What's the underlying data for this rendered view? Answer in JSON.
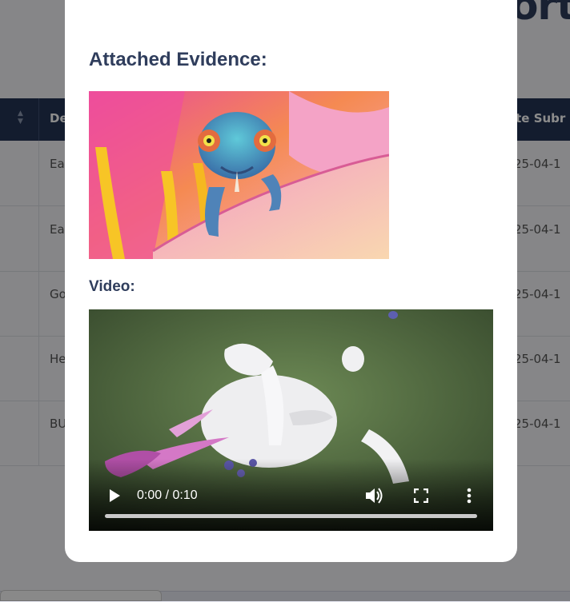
{
  "background": {
    "title_fragment": "ort",
    "table": {
      "headers": {
        "description": "De",
        "date_submitted": "ate Subr"
      },
      "rows": [
        {
          "description": "Ea",
          "date": "25-04-1"
        },
        {
          "description": "Ea",
          "date": "25-04-1"
        },
        {
          "description": "Go",
          "date": "25-04-1"
        },
        {
          "description": "He",
          "date": "25-04-1"
        },
        {
          "description": "BU",
          "date": "25-04-1"
        }
      ]
    }
  },
  "modal": {
    "evidence_heading": "Attached Evidence:",
    "video_label": "Video:",
    "video": {
      "current_time": "0:00",
      "duration": "0:10",
      "time_separator": " / ",
      "progress_fraction": 0
    }
  },
  "icons": {
    "play": "play-icon",
    "volume": "volume-icon",
    "fullscreen": "fullscreen-icon",
    "more": "more-vertical-icon",
    "sort": "sort-arrows-icon"
  }
}
